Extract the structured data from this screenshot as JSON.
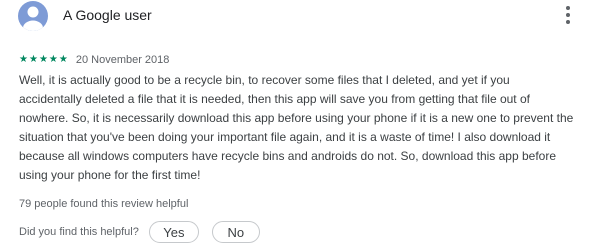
{
  "review": {
    "author": "A Google user",
    "rating": 5,
    "rating_max": 5,
    "date": "20 November 2018",
    "text": "Well, it is actually good to be a recycle bin, to recover some files that I deleted, and yet if you accidentally deleted a file that it is needed, then this app will save you from getting that file out of nowhere. So, it is necessarily download this app before using your phone if it is a new one to prevent the situation that you've been doing your important file again, and it is a waste of time! I also download it because all windows computers have recycle bins and androids do not. So, download this app before using your phone for the first time!",
    "helpful_count_text": "79 people found this review helpful"
  },
  "feedback": {
    "question": "Did you find this helpful?",
    "yes_label": "Yes",
    "no_label": "No"
  },
  "icons": {
    "avatar": "person-silhouette-icon",
    "more": "more-vertical-icon",
    "star": "star-icon"
  },
  "colors": {
    "star": "#01875f",
    "avatar_bg": "#7e9bd6",
    "avatar_fg": "#ffffff"
  }
}
